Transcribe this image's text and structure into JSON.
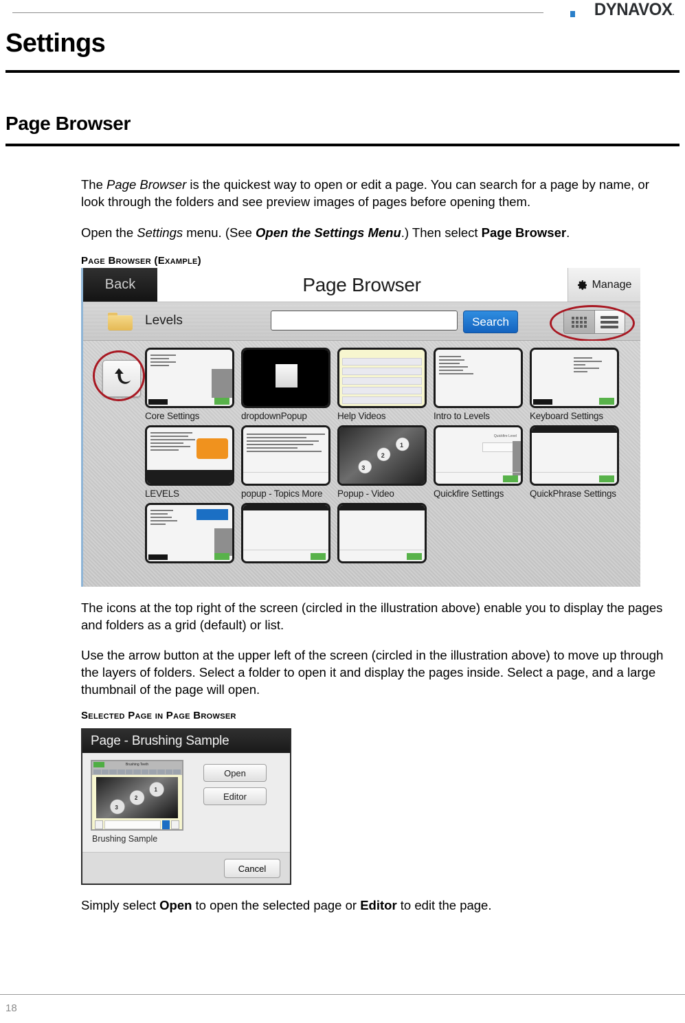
{
  "header": {
    "logo_text": "DYNAVOX",
    "logo_accent_color": "#2a7fc9"
  },
  "document": {
    "page_title": "Settings",
    "section_title": "Page Browser",
    "page_number": "18"
  },
  "paragraphs": {
    "intro_part1": "The ",
    "intro_italic1": "Page Browser",
    "intro_part2": " is the quickest way to open or edit a page. You can search for a page by name, or look through the folders and see preview images of pages before opening them.",
    "open_part1": "Open the ",
    "open_italic1": "Settings",
    "open_part2": " menu. (See ",
    "open_bolditalic": "Open the Settings Menu",
    "open_part3": ".) Then select ",
    "open_bold": "Page Browser",
    "open_part4": ".",
    "icons_text": "The icons at the top right of the screen (circled in the illustration above) enable you to display the pages and folders as a grid (default) or list.",
    "arrow_text": "Use the arrow button at the upper left of the screen (circled in the illustration above) to move up through the layers of folders. Select a folder to open it and display the pages inside. Select a page, and a large thumbnail of the page will open.",
    "simply_part1": "Simply select ",
    "simply_bold1": "Open",
    "simply_part2": " to open the selected page or ",
    "simply_bold2": "Editor",
    "simply_part3": " to edit the page."
  },
  "captions": {
    "figure1": "Page Browser (Example)",
    "figure2": "Selected Page in Page Browser"
  },
  "page_browser": {
    "back_label": "Back",
    "title": "Page Browser",
    "manage_label": "Manage",
    "folder_label": "Levels",
    "search_value": "",
    "search_placeholder": "",
    "search_button": "Search",
    "view_grid_selected": true,
    "thumbnails": [
      [
        {
          "label": "Core Settings",
          "kind": "settings"
        },
        {
          "label": "dropdownPopup",
          "kind": "black"
        },
        {
          "label": "Help Videos",
          "kind": "yellow-list"
        },
        {
          "label": "Intro to Levels",
          "kind": "text-grid"
        },
        {
          "label": "Keyboard Settings",
          "kind": "keyboard"
        }
      ],
      [
        {
          "label": "LEVELS",
          "kind": "levels"
        },
        {
          "label": "popup - Topics More",
          "kind": "text-doc"
        },
        {
          "label": "Popup - Video",
          "kind": "film"
        },
        {
          "label": "Quickfire Settings",
          "kind": "quickfire"
        },
        {
          "label": "QuickPhrase Settings",
          "kind": "plain"
        }
      ],
      [
        {
          "label": "",
          "kind": "form"
        },
        {
          "label": "",
          "kind": "plain"
        },
        {
          "label": "",
          "kind": "plain"
        }
      ]
    ],
    "keyboard_thumb_items": [
      "QWERTY",
      "QwikWriting Screen",
      "ABC",
      "ABC Student Overview",
      "ALRS"
    ],
    "quickfire_thumb_label": "Quickfire Level",
    "film_numbers": [
      "3",
      "2",
      "1"
    ]
  },
  "selected_page_dialog": {
    "title": "Page - Brushing Sample",
    "thumb_page_title": "Brushing Teeth",
    "caption": "Brushing Sample",
    "open_label": "Open",
    "editor_label": "Editor",
    "cancel_label": "Cancel",
    "film_numbers": [
      "3",
      "2",
      "1"
    ]
  }
}
